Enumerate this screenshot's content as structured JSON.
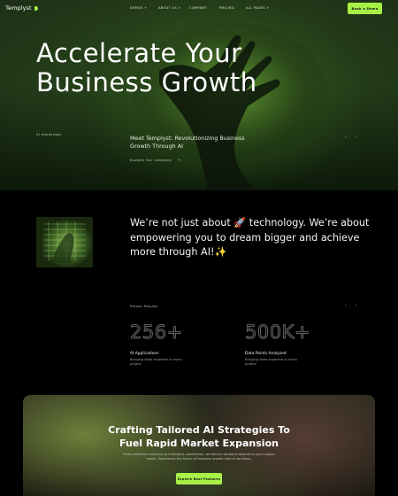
{
  "nav": {
    "logo": "Templyst",
    "links": [
      "Demos +",
      "About Us +",
      "Company",
      "Pricing",
      "All Pages +"
    ],
    "book_button": "Book a Demo"
  },
  "hero": {
    "title_line1": "Accelerate Your",
    "title_line2": "Business Growth",
    "eyebrow": "AI Advantage",
    "meet_text": "Meet Templyst: Revolutionizing Business Growth Through AI",
    "explore_link": "Explore Our Company",
    "explore_arrow": "→",
    "prev_arrow": "‹",
    "next_arrow": "›"
  },
  "intro": {
    "text": "We’re not just about 🚀 technology. We’re about empowering you to dream bigger and achieve more through AI!✨"
  },
  "results": {
    "eyebrow": "Proven Results",
    "prev_arrow": "‹",
    "next_arrow": "›",
    "stats": [
      {
        "value": "256+",
        "label": "AI Applications",
        "desc": "Bringing deep expertise to every project."
      },
      {
        "value": "500K+",
        "label": "Data Points Analyzed",
        "desc": "Bringing deep expertise to every project."
      }
    ]
  },
  "cta": {
    "title_line1": "Crafting Tailored AI Strategies To",
    "title_line2": "Fuel Rapid Market Expansion",
    "desc": "From predictive analytics to intelligent automation, we deliver solutions tailored to your unique needs. Experience the future of business growth with AI solutions.",
    "button": "Explore Best Features"
  },
  "colors": {
    "accent": "#a8f047",
    "background": "#000000"
  }
}
